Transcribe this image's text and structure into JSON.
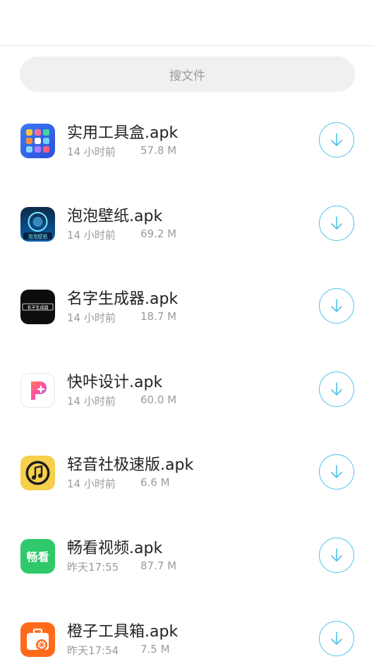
{
  "search": {
    "placeholder": "搜文件"
  },
  "files": [
    {
      "name": "实用工具盒.apk",
      "time": "14 小时前",
      "size": "57.8 M",
      "icon": "toolbox-app-icon"
    },
    {
      "name": "泡泡壁纸.apk",
      "time": "14 小时前",
      "size": "69.2 M",
      "icon": "bubble-wallpaper-app-icon",
      "icon_text": "泡泡壁纸"
    },
    {
      "name": "名字生成器.apk",
      "time": "14 小时前",
      "size": "18.7 M",
      "icon": "name-generator-app-icon",
      "icon_text": "名字生成器"
    },
    {
      "name": "快咔设计.apk",
      "time": "14 小时前",
      "size": "60.0 M",
      "icon": "kuaika-design-app-icon"
    },
    {
      "name": "轻音社极速版.apk",
      "time": "14 小时前",
      "size": "6.6 M",
      "icon": "music-note-app-icon"
    },
    {
      "name": "畅看视频.apk",
      "time": "昨天17:55",
      "size": "87.7 M",
      "icon": "changkan-video-app-icon",
      "icon_text": "畅看"
    },
    {
      "name": "橙子工具箱.apk",
      "time": "昨天17:54",
      "size": "7.5 M",
      "icon": "orange-toolbox-app-icon"
    }
  ],
  "colors": {
    "accent": "#4fc3e8",
    "text": "#222222",
    "secondary_text": "#9b9b9b",
    "search_bg": "#f0f0f0"
  }
}
